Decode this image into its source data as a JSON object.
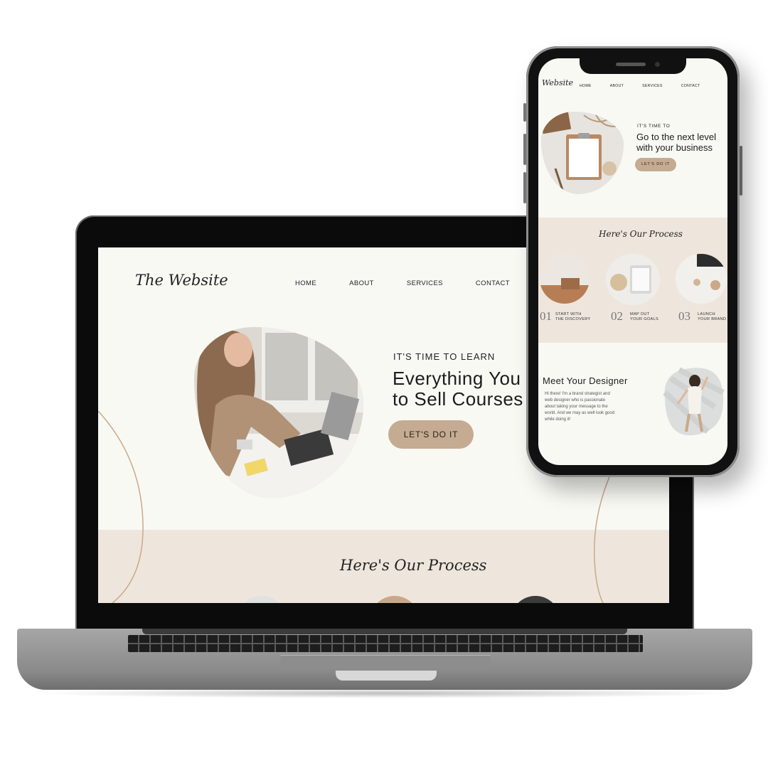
{
  "desktop": {
    "logo": "The Website",
    "nav": [
      "HOME",
      "ABOUT",
      "SERVICES",
      "CONTACT"
    ],
    "hero": {
      "eyebrow": "IT'S TIME TO LEARN",
      "headline_line1": "Everything You",
      "headline_line2": "to Sell Courses",
      "button": "LET'S DO IT"
    },
    "process_title": "Here's Our Process"
  },
  "mobile": {
    "logo": "Website",
    "nav": [
      "HOME",
      "ABOUT",
      "SERVICES",
      "CONTACT"
    ],
    "hero": {
      "eyebrow": "IT'S TIME TO",
      "headline_line1": "Go to the next level",
      "headline_line2": "with your business",
      "button": "LET'S DO IT"
    },
    "process_title": "Here's Our Process",
    "steps": [
      {
        "num": "01",
        "line1": "START WITH",
        "line2": "THE DISCOVERY"
      },
      {
        "num": "02",
        "line1": "MAP OUT",
        "line2": "YOUR GOALS"
      },
      {
        "num": "03",
        "line1": "LAUNCH",
        "line2": "YOUR BRAND"
      }
    ],
    "designer": {
      "title": "Meet Your Designer",
      "body_lines": [
        "Hi there! I'm a brand strategist and",
        "web designer who is passionate",
        "about taking your message to the",
        "world. And we may as well look good",
        "while doing it!"
      ]
    }
  },
  "colors": {
    "page_bg": "#f9f9f4",
    "accent": "#c5ab92",
    "band": "#eee6dc",
    "text": "#1c1c1c"
  }
}
